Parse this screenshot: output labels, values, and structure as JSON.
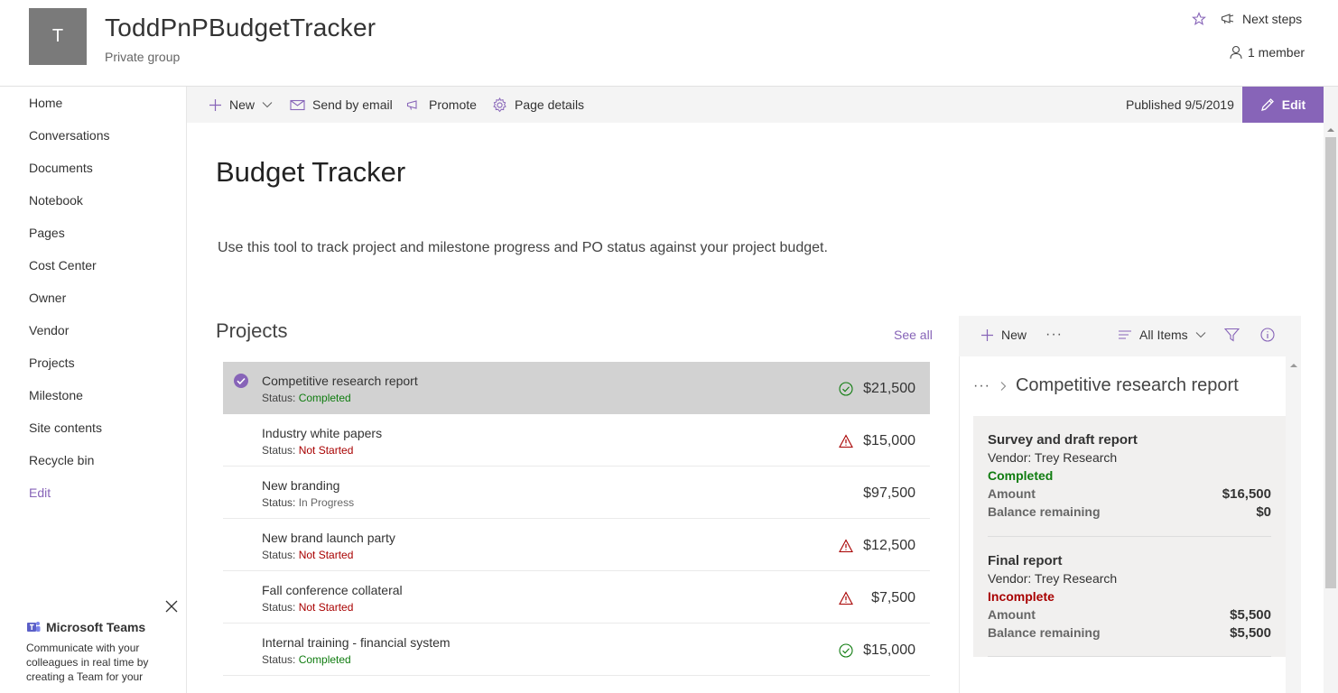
{
  "header": {
    "logo_letter": "T",
    "site_title": "ToddPnPBudgetTracker",
    "site_subtitle": "Private group",
    "next_steps": "Next steps",
    "members": "1 member"
  },
  "nav": {
    "items": [
      {
        "label": "Home"
      },
      {
        "label": "Conversations"
      },
      {
        "label": "Documents"
      },
      {
        "label": "Notebook"
      },
      {
        "label": "Pages"
      },
      {
        "label": "Cost Center"
      },
      {
        "label": "Owner"
      },
      {
        "label": "Vendor"
      },
      {
        "label": "Projects"
      },
      {
        "label": "Milestone"
      },
      {
        "label": "Site contents"
      },
      {
        "label": "Recycle bin"
      }
    ],
    "edit": "Edit"
  },
  "teams": {
    "title": "Microsoft Teams",
    "description": "Communicate with your colleagues in real time by creating a Team for your"
  },
  "command_bar": {
    "new": "New",
    "send_by_email": "Send by email",
    "promote": "Promote",
    "page_details": "Page details",
    "published": "Published 9/5/2019",
    "edit": "Edit"
  },
  "page": {
    "title": "Budget Tracker",
    "description": "Use this tool to track project and milestone progress and PO status against your project budget."
  },
  "projects": {
    "title": "Projects",
    "see_all": "See all",
    "status_prefix": "Status:",
    "rows": [
      {
        "name": "Competitive research report",
        "status": "Completed",
        "amount": "$21,500",
        "icon": "check-circle-icon"
      },
      {
        "name": "Industry white papers",
        "status": "Not Started",
        "amount": "$15,000",
        "icon": "warning-icon"
      },
      {
        "name": "New branding",
        "status": "In Progress",
        "amount": "$97,500",
        "icon": ""
      },
      {
        "name": "New brand launch party",
        "status": "Not Started",
        "amount": "$12,500",
        "icon": "warning-icon"
      },
      {
        "name": "Fall conference collateral",
        "status": "Not Started",
        "amount": "$7,500",
        "icon": "warning-icon"
      },
      {
        "name": "Internal training - financial system",
        "status": "Completed",
        "amount": "$15,000",
        "icon": "check-circle-icon"
      }
    ]
  },
  "milestones": {
    "toolbar": {
      "new": "New",
      "more": "···",
      "view": "All Items"
    },
    "breadcrumb": {
      "dots": "···",
      "title": "Competitive research report"
    },
    "cards": [
      {
        "title": "Survey and draft report",
        "vendor": "Vendor: Trey Research",
        "state": "Completed",
        "amount_label": "Amount",
        "amount": "$16,500",
        "balance_label": "Balance remaining",
        "balance": "$0"
      },
      {
        "title": "Final report",
        "vendor": "Vendor: Trey Research",
        "state": "Incomplete",
        "amount_label": "Amount",
        "amount": "$5,500",
        "balance_label": "Balance remaining",
        "balance": "$5,500"
      }
    ]
  },
  "colors": {
    "accent": "#8764b8",
    "completed": "#107c10",
    "not_started": "#a80000",
    "selected_row": "#d2d2d2"
  }
}
